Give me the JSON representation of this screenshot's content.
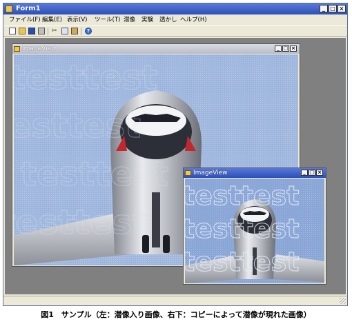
{
  "main_window": {
    "title": "Form1",
    "controls": {
      "minimize": "_",
      "maximize": "□",
      "close": "×"
    }
  },
  "menu": [
    {
      "label": "ファイル(F)"
    },
    {
      "label": "編集(E)"
    },
    {
      "label": "表示(V)"
    },
    {
      "label": "ツール(T)"
    },
    {
      "label": "潜像"
    },
    {
      "label": "実験"
    },
    {
      "label": "透かし"
    },
    {
      "label": "ヘルプ(H)"
    }
  ],
  "toolbar_icons": [
    "new-icon",
    "open-icon",
    "save-icon",
    "print-icon",
    "cut-icon",
    "copy-icon",
    "paste-icon",
    "help-icon"
  ],
  "child_windows": [
    {
      "title": "ImageView",
      "state": "inactive",
      "controls": {
        "minimize": "_",
        "maximize": "□",
        "close": "×"
      }
    },
    {
      "title": "ImageView",
      "state": "active",
      "controls": {
        "minimize": "_",
        "maximize": "□",
        "close": "×"
      }
    }
  ],
  "watermark_text": "testtest",
  "caption": "図1　サンプル（左：潜像入り画像、右下：コピーによって潜像が現れた画像）",
  "colors": {
    "titlebar_active": "#2b4fb8",
    "titlebar_inactive": "#c4c7d0",
    "mdi_background": "#808080",
    "sky": "#9db4dc"
  }
}
